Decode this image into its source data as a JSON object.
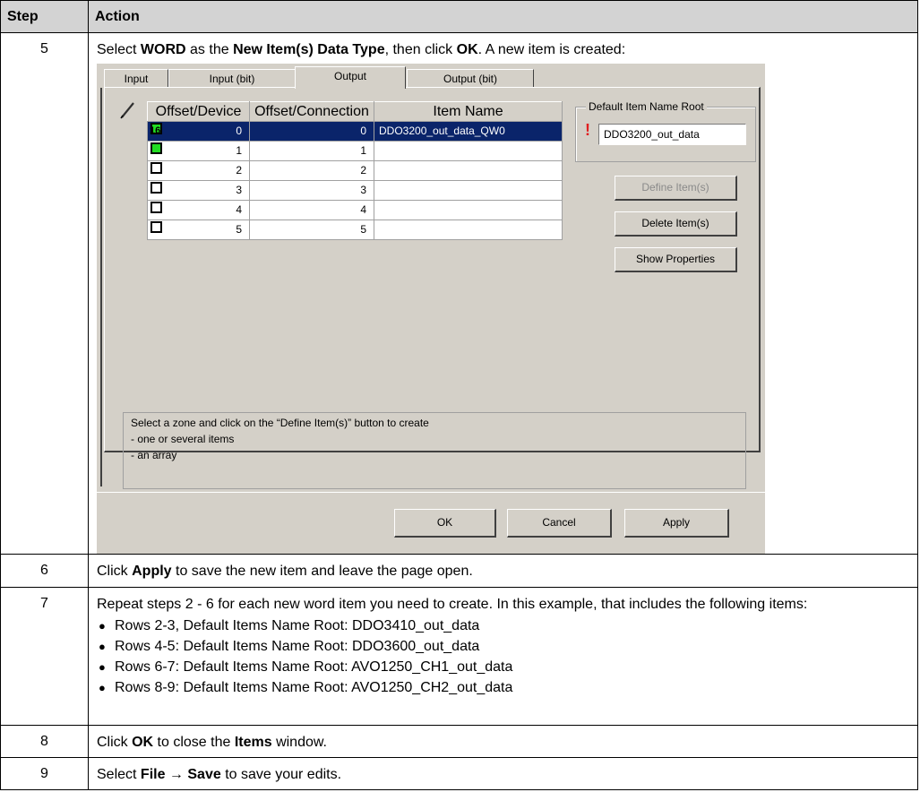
{
  "table": {
    "header_step": "Step",
    "header_action": "Action"
  },
  "row5": {
    "step": "5",
    "text_1": "Select ",
    "bold_1": "WORD",
    "text_2": " as the ",
    "bold_2": "New Item(s) Data Type",
    "text_3": ", then click ",
    "bold_3": "OK",
    "text_4": ". A new item is created:"
  },
  "dialog": {
    "tabs": [
      "Input",
      "Input (bit)",
      "Output",
      "Output (bit)"
    ],
    "grid_headers": [
      "Offset/Device",
      "Offset/Connection",
      "Item Name"
    ],
    "rows": [
      {
        "device": "0",
        "connection": "0",
        "name": "DDO3200_out_data_QW0",
        "badge": "16"
      },
      {
        "device": "1",
        "connection": "1",
        "name": "",
        "badge": ""
      },
      {
        "device": "2",
        "connection": "2",
        "name": "",
        "badge": ""
      },
      {
        "device": "3",
        "connection": "3",
        "name": "",
        "badge": ""
      },
      {
        "device": "4",
        "connection": "4",
        "name": "",
        "badge": ""
      },
      {
        "device": "5",
        "connection": "5",
        "name": "",
        "badge": ""
      }
    ],
    "root_group_title": "Default Item Name Root",
    "root_value": "DDO3200_out_data",
    "define_label": "Define Item(s)",
    "delete_label": "Delete Item(s)",
    "properties_label": "Show Properties",
    "hint_lines": [
      "Select a zone and click on the “Define Item(s)” button to create",
      "- one or several items",
      "- an array"
    ],
    "ok_label": "OK",
    "cancel_label": "Cancel",
    "apply_label": "Apply"
  },
  "row6": {
    "step": "6",
    "text_1": "Click ",
    "bold_1": "Apply",
    "text_2": " to save the new item and leave the page open."
  },
  "row7": {
    "step": "7",
    "text": "Repeat steps 2 - 6 for each new word item you need to create. In this example, that includes the following items:",
    "bullets": [
      "Rows 2-3, Default Items Name Root: DDO3410_out_data",
      "Rows 4-5: Default Items Name Root: DDO3600_out_data",
      "Rows 6-7: Default Items Name Root: AVO1250_CH1_out_data",
      "Rows 8-9: Default Items Name Root: AVO1250_CH2_out_data"
    ]
  },
  "row8": {
    "step": "8",
    "text_1": "Click ",
    "bold_1": "OK",
    "text_2": " to close the ",
    "bold_2": "Items",
    "text_3": " window."
  },
  "row9": {
    "step": "9",
    "text_1": "Select ",
    "bold_1": "File → Save",
    "text_2": " to save your edits."
  }
}
